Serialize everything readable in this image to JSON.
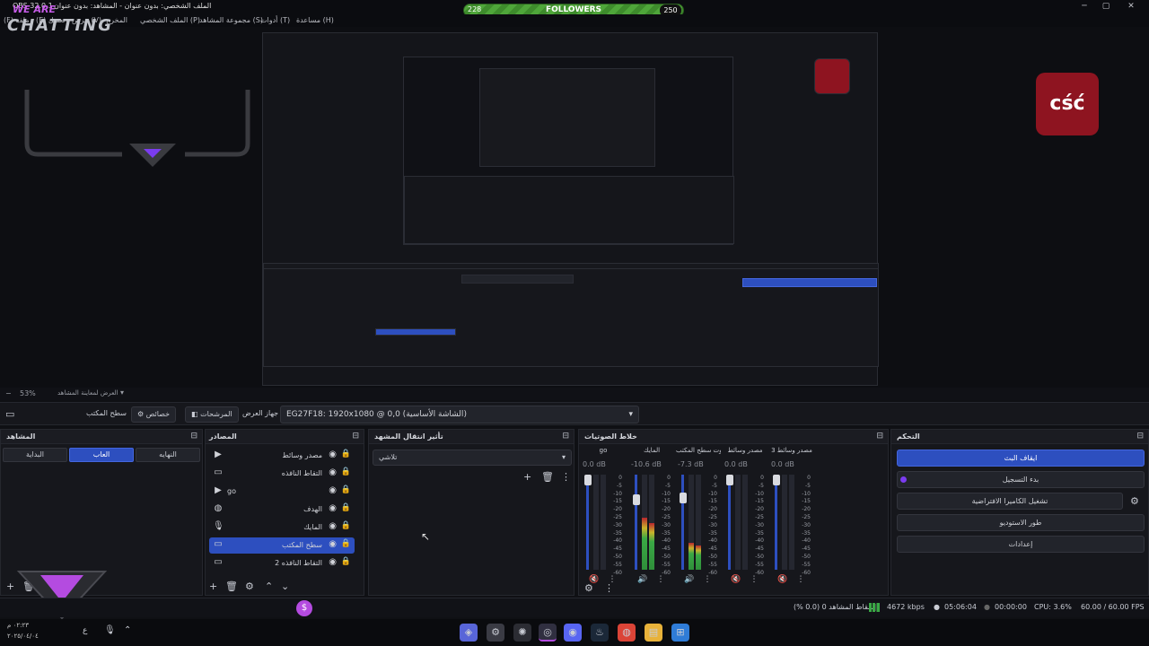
{
  "window": {
    "title": "الملف الشخصي: بدون عنوان - المشاهد: بدون عنوان",
    "app": "OBS 32.0.1",
    "controls": {
      "minimize": "─",
      "maximize": "▢",
      "close": "✕"
    }
  },
  "overlay": {
    "brand_top": "WE ARE",
    "brand_bottom": "CHATTING"
  },
  "menu": [
    "مساعدة (H)",
    "أدوات (T)",
    "مجموعة المشاهد (S)",
    "الملف الشخصي (P)",
    "المخرج",
    "عرض (V)",
    "(E) تعديل",
    "(F) ملف"
  ],
  "followers": {
    "current": "228",
    "label": "FOLLOWERS",
    "goal": "250"
  },
  "preview": {
    "badge_text": "cść",
    "zoom": "53%",
    "zoom_label": "العرض لمعاينة المشاهد"
  },
  "context": {
    "label_desktop": "سطح المكتب",
    "properties": "خصائص",
    "filters": "المرشحات",
    "device_label": "جهاز العرض",
    "device_value": "EG27F18: 1920x1080 @ 0,0 (الشاشة الأساسية)"
  },
  "scenes": {
    "title": "المشاهد",
    "items": [
      "النهايه",
      "العاب",
      "البداية"
    ],
    "active_index": 1
  },
  "sources": {
    "title": "المصادر",
    "items": [
      {
        "name": "مصدر وسائط",
        "icon": "▶",
        "selected": false
      },
      {
        "name": "التقاط النافذه",
        "icon": "▭",
        "selected": false
      },
      {
        "name": "go",
        "icon": "▶",
        "selected": false
      },
      {
        "name": "الهدف",
        "icon": "◍",
        "selected": false
      },
      {
        "name": "المايك",
        "icon": "🎙",
        "selected": false
      },
      {
        "name": "سطح المكتب",
        "icon": "▭",
        "selected": true
      },
      {
        "name": "التقاط النافذه 2",
        "icon": "▭",
        "selected": false
      }
    ]
  },
  "transitions": {
    "title": "تأثير انتقال المشهد",
    "value": "تلاشي"
  },
  "mixer": {
    "title": "خلاط الصوتيات",
    "channels": [
      {
        "name": "go",
        "db": "0.0 dB",
        "level": 0
      },
      {
        "name": "المايك",
        "db": "-10.6 dB",
        "level": 0.55
      },
      {
        "name": "صوت سطح المكتب",
        "db": "-7.3 dB",
        "level": 0.28
      },
      {
        "name": "مصدر وسائط",
        "db": "0.0 dB",
        "level": 0
      },
      {
        "name": "مصدر وسائط 3",
        "db": "0.0 dB",
        "level": 0
      }
    ],
    "scale": [
      "0",
      "-5",
      "-10",
      "-15",
      "-20",
      "-25",
      "-30",
      "-35",
      "-40",
      "-45",
      "-50",
      "-55",
      "-60"
    ]
  },
  "controls": {
    "title": "التحكم",
    "buttons": [
      "ايقاف البث",
      "بدء التسجيل",
      "تشغيل الكاميرا الافتراضية",
      "طور الاستوديو",
      "إعدادات"
    ]
  },
  "status": {
    "dropped": "إسقاط المشاهد 0 (0.0 %)",
    "bitrate": "4672 kbps",
    "stream_time": "05:06:04",
    "rec_time": "00:00:00",
    "cpu": "CPU: 3.6%",
    "fps": "60.00 / 60.00 FPS"
  },
  "taskbar": {
    "time": "٠٢:٢٣ م",
    "date": "٢٠٢٥/٠٤/٠٤"
  },
  "colors": {
    "accent": "#2d4fbf",
    "record_dot": "#7b3cf0",
    "followers_green": "#4fa63a",
    "badge_red": "#8e1420"
  }
}
